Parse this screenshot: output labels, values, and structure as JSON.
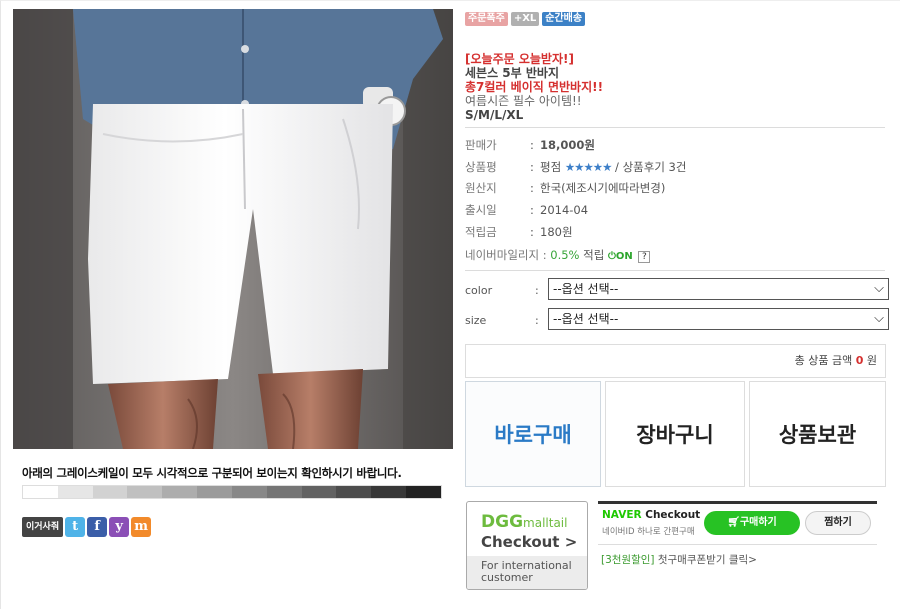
{
  "product_image": {
    "alt": "white shorts model photo"
  },
  "gray_note": "아래의 그레이스케일이 모두 시각적으로 구분되어 보이는지 확인하시기 바랍니다.",
  "grayscale": [
    "#ffffff",
    "#e6e6e6",
    "#d2d2d2",
    "#c0c0c0",
    "#adadad",
    "#9b9b9b",
    "#888888",
    "#757575",
    "#626262",
    "#4d4d4d",
    "#383838",
    "#222222"
  ],
  "share": {
    "this_label": "이거사줘",
    "icons": [
      {
        "name": "twitter-icon",
        "glyph": "t",
        "color": "#4fb3e8"
      },
      {
        "name": "facebook-icon",
        "glyph": "f",
        "color": "#3b5ea8"
      },
      {
        "name": "yozm-icon",
        "glyph": "y",
        "color": "#8b4fb6"
      },
      {
        "name": "me2day-icon",
        "glyph": "m",
        "color": "#f28a2a"
      }
    ]
  },
  "badges": [
    {
      "label": "주문폭주",
      "style": "pink"
    },
    {
      "label": "+XL",
      "style": "gray"
    },
    {
      "label": "순간배송",
      "style": "blue"
    }
  ],
  "headline": {
    "line1": "[오늘주문 오늘받자!]",
    "line2": "세븐스 5부 반바지",
    "line3": "총7컬러 베이직 면반바지!!",
    "line4": "여름시즌 필수 아이템!!",
    "line5": "S/M/L/XL"
  },
  "info": {
    "price_label": "판매가",
    "price_value": "18,000원",
    "review_label": "상품평",
    "review_value_pre": "평점",
    "review_stars": "★★★★★",
    "review_value_post": "/ 상품후기 3건",
    "origin_label": "원산지",
    "origin_value": "한국(제조시기에따라변경)",
    "release_label": "출시일",
    "release_value": "2014-04",
    "points_label": "적립금",
    "points_value": "180원",
    "mileage_label": "네이버마일리지",
    "mileage_rate": "0.5%",
    "mileage_suffix": "적립",
    "mileage_on": "ON",
    "mileage_help": "?"
  },
  "options": [
    {
      "label": "color",
      "value": "--옵션 선택--"
    },
    {
      "label": "size",
      "value": "--옵션 선택--"
    }
  ],
  "total": {
    "label": "총 상품 금액",
    "amount": "0",
    "unit": "원"
  },
  "actions": {
    "buy_now": "바로구매",
    "cart": "장바구니",
    "wishlist": "상품보관"
  },
  "dgg": {
    "logo_main": "DGG",
    "logo_sub": "malltail",
    "checkout": "Checkout >",
    "footer_line1": "For international",
    "footer_line2": "customer"
  },
  "naver": {
    "brand": "NAVER",
    "title": "Checkout",
    "sub": "네이버ID 하나로 간편구매",
    "buy_label": "구매하기",
    "wish_label": "찜하기"
  },
  "coupon": {
    "tag": "[3천원할인]",
    "text": "첫구매쿠폰받기 클릭>"
  }
}
